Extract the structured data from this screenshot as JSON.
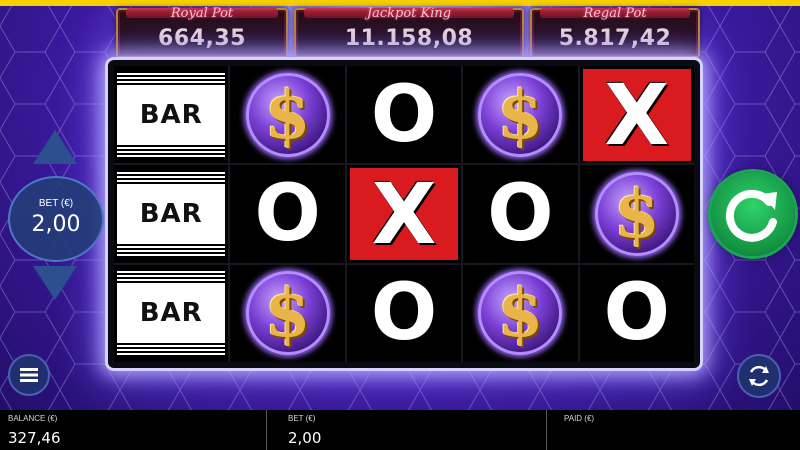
{
  "jackpots": [
    {
      "title": "Royal Pot",
      "amount": "664,35"
    },
    {
      "title": "Jackpot King",
      "amount": "11.158,08"
    },
    {
      "title": "Regal Pot",
      "amount": "5.817,42"
    }
  ],
  "reels": {
    "symbols": {
      "bar": "BAR",
      "o": "O",
      "x": "X",
      "dollar": "$"
    },
    "grid": [
      [
        "bar",
        "dollar",
        "o",
        "dollar",
        "x"
      ],
      [
        "bar",
        "o",
        "x",
        "o",
        "dollar"
      ],
      [
        "bar",
        "dollar",
        "o",
        "dollar",
        "o"
      ]
    ]
  },
  "bet_control": {
    "label": "BET (€)",
    "value": "2,00",
    "up_icon": "triangle-up-icon",
    "down_icon": "triangle-down-icon"
  },
  "buttons": {
    "spin_icon": "spin-arrow-icon",
    "menu_icon": "hamburger-menu-icon",
    "autoplay_icon": "autoplay-refresh-icon"
  },
  "status": {
    "balance_label": "BALANCE (€)",
    "balance_value": "327,46",
    "bet_label": "BET (€)",
    "bet_value": "2,00",
    "paid_label": "PAID (€)",
    "paid_value": ""
  },
  "colors": {
    "accent_yellow": "#f7d000",
    "x_red": "#d91b1f",
    "spin_green": "#139243",
    "bet_blue": "#2c4f8f",
    "gold": "#e9b54a"
  }
}
